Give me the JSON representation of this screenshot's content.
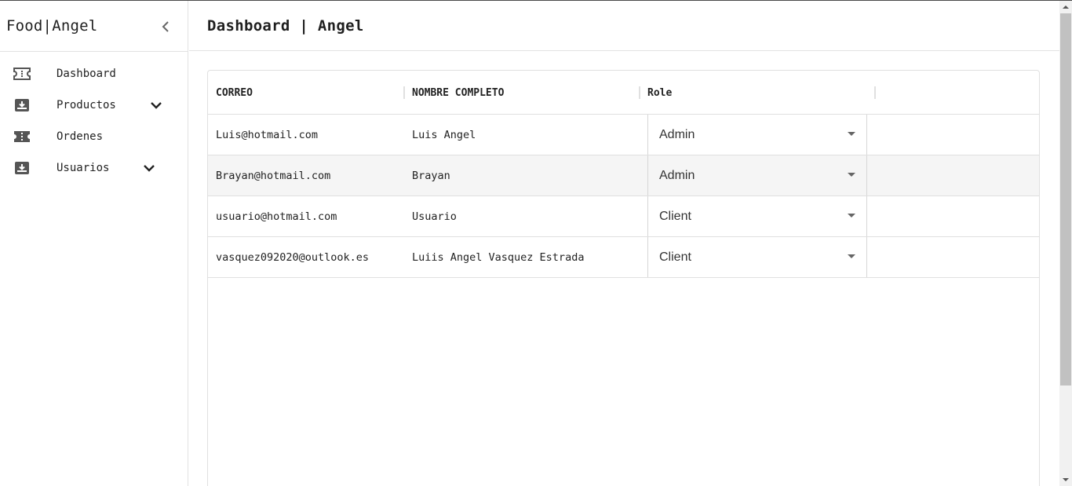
{
  "app": {
    "brand": "Food|Angel"
  },
  "sidebar": {
    "items": [
      {
        "label": "Dashboard",
        "icon": "ticket-icon",
        "expandable": false
      },
      {
        "label": "Productos",
        "icon": "inbox-download-icon",
        "expandable": true
      },
      {
        "label": "Ordenes",
        "icon": "ticket-filled-icon",
        "expandable": false
      },
      {
        "label": "Usuarios",
        "icon": "inbox-download-icon",
        "expandable": true
      }
    ]
  },
  "header": {
    "title": "Dashboard | Angel"
  },
  "table": {
    "columns": [
      "CORREO",
      "NOMBRE COMPLETO",
      "Role"
    ],
    "rows": [
      {
        "correo": "Luis@hotmail.com",
        "nombre": "Luis Angel",
        "role": "Admin"
      },
      {
        "correo": "Brayan@hotmail.com",
        "nombre": "Brayan",
        "role": "Admin"
      },
      {
        "correo": "usuario@hotmail.com",
        "nombre": "Usuario",
        "role": "Client"
      },
      {
        "correo": "vasquez092020@outlook.es",
        "nombre": "Luiis Angel Vasquez Estrada",
        "role": "Client"
      }
    ]
  },
  "colors": {
    "border": "#e0e0e0",
    "row_alt": "#f5f5f5",
    "text": "#222222",
    "scroll_thumb": "#c1c1c1"
  }
}
